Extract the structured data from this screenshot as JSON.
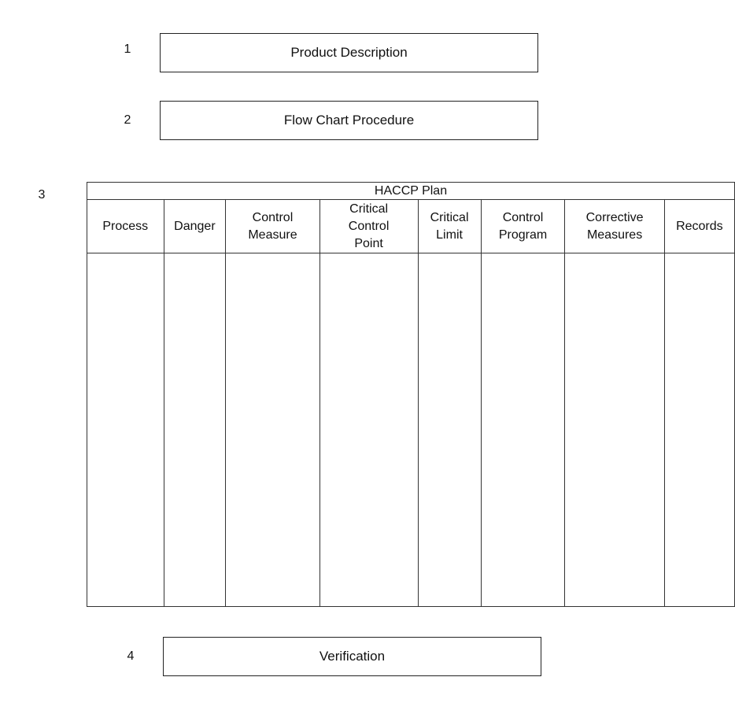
{
  "steps": [
    {
      "number": "1",
      "label": "Product Description"
    },
    {
      "number": "2",
      "label": "Flow Chart Procedure"
    },
    {
      "number": "3"
    },
    {
      "number": "4",
      "label": "Verification"
    }
  ],
  "haccp_table": {
    "title": "HACCP Plan",
    "columns": [
      "Process",
      "Danger",
      "Control Measure",
      "Critical Control Point",
      "Critical Limit",
      "Control Program",
      "Corrective Measures",
      "Records"
    ]
  }
}
